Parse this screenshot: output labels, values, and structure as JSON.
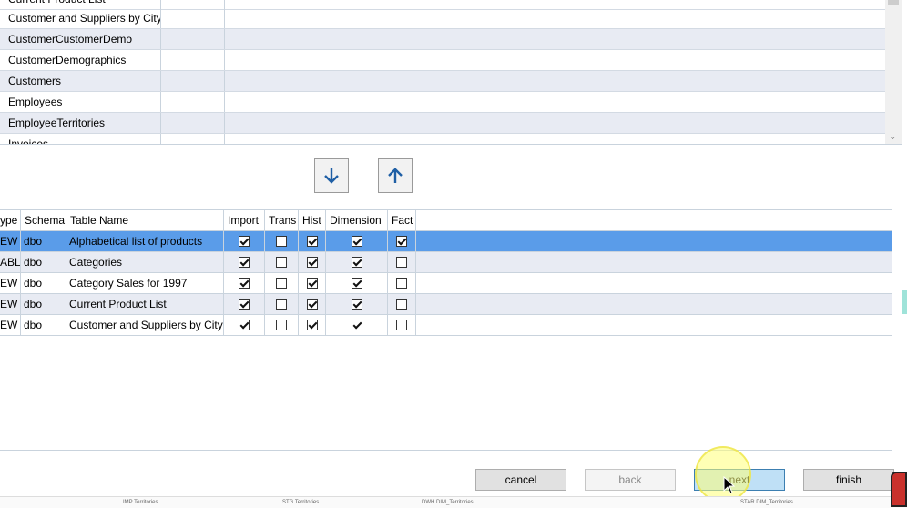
{
  "source_list": {
    "items": [
      "Current Product List",
      "Customer and Suppliers by City",
      "CustomerCustomerDemo",
      "CustomerDemographics",
      "Customers",
      "Employees",
      "EmployeeTerritories",
      "Invoices"
    ]
  },
  "move": {
    "down_icon": "arrow-down-icon",
    "up_icon": "arrow-up-icon"
  },
  "grid": {
    "headers": {
      "type": "ype",
      "schema": "Schema",
      "name": "Table Name",
      "import": "Import",
      "trans": "Trans",
      "hist": "Hist",
      "dimension": "Dimension",
      "fact": "Fact"
    },
    "rows": [
      {
        "type": "EW",
        "schema": "dbo",
        "name": "Alphabetical list of products",
        "import": true,
        "trans": false,
        "hist": true,
        "dimension": true,
        "fact": true,
        "selected": true
      },
      {
        "type": "ABLE",
        "schema": "dbo",
        "name": "Categories",
        "import": true,
        "trans": false,
        "hist": true,
        "dimension": true,
        "fact": false,
        "selected": false
      },
      {
        "type": "EW",
        "schema": "dbo",
        "name": "Category Sales for 1997",
        "import": true,
        "trans": false,
        "hist": true,
        "dimension": true,
        "fact": false,
        "selected": false
      },
      {
        "type": "EW",
        "schema": "dbo",
        "name": "Current Product List",
        "import": true,
        "trans": false,
        "hist": true,
        "dimension": true,
        "fact": false,
        "selected": false
      },
      {
        "type": "EW",
        "schema": "dbo",
        "name": "Customer and Suppliers by City",
        "import": true,
        "trans": false,
        "hist": true,
        "dimension": true,
        "fact": false,
        "selected": false
      }
    ]
  },
  "buttons": {
    "cancel": "cancel",
    "back": "back",
    "next": "next",
    "finish": "finish"
  },
  "background_strip": {
    "labels": [
      "IMP Territories",
      "STG Territories",
      "DWH DIM_Territories",
      "STAR DIM_Territories"
    ]
  },
  "colors": {
    "selected_row": "#5a9ce9",
    "alt_row": "#e8ebf3",
    "accent_arrow": "#1f5fa5"
  }
}
